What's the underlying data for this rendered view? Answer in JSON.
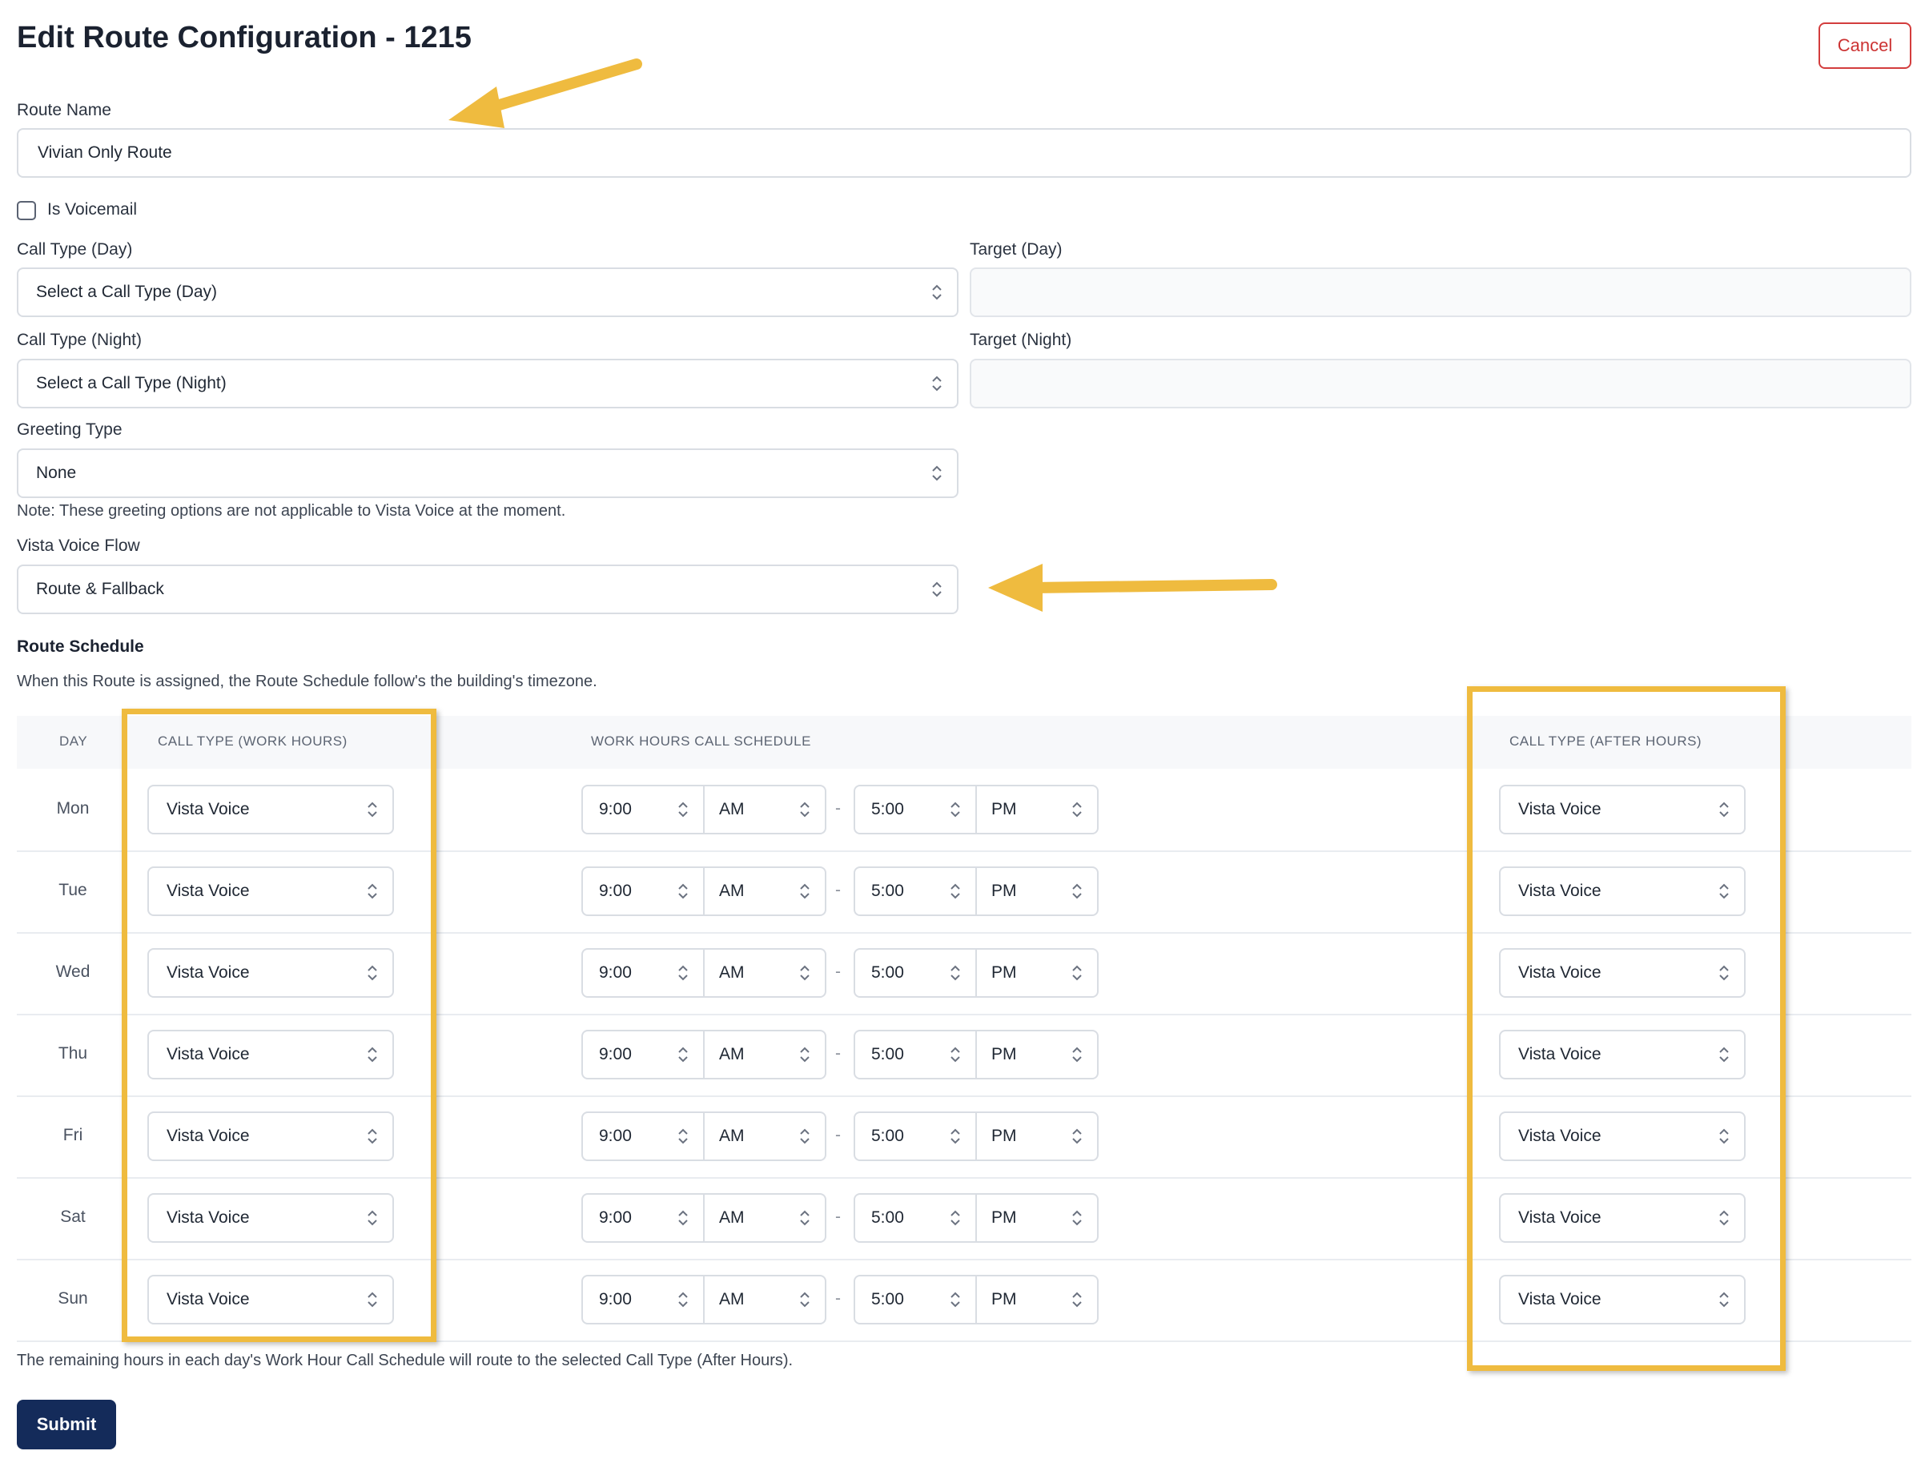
{
  "header": {
    "title": "Edit Route Configuration - 1215",
    "cancel_label": "Cancel"
  },
  "form": {
    "route_name_label": "Route Name",
    "route_name_value": "Vivian Only Route",
    "is_voicemail_label": "Is Voicemail",
    "is_voicemail_checked": false,
    "call_type_day_label": "Call Type (Day)",
    "call_type_day_value": "Select a Call Type (Day)",
    "target_day_label": "Target (Day)",
    "target_day_value": "",
    "call_type_night_label": "Call Type (Night)",
    "call_type_night_value": "Select a Call Type (Night)",
    "target_night_label": "Target (Night)",
    "target_night_value": "",
    "greeting_type_label": "Greeting Type",
    "greeting_type_value": "None",
    "greeting_note": "Note: These greeting options are not applicable to Vista Voice at the moment.",
    "vista_flow_label": "Vista Voice Flow",
    "vista_flow_value": "Route & Fallback"
  },
  "schedule": {
    "title": "Route Schedule",
    "description": "When this Route is assigned, the Route Schedule follow's the building's timezone.",
    "columns": {
      "day": "DAY",
      "work_type": "CALL TYPE (WORK HOURS)",
      "work_schedule": "WORK HOURS CALL SCHEDULE",
      "after_type": "CALL TYPE (AFTER HOURS)"
    },
    "rows": [
      {
        "day": "Mon",
        "work_type": "Vista Voice",
        "start": "9:00",
        "start_ampm": "AM",
        "end": "5:00",
        "end_ampm": "PM",
        "after_type": "Vista Voice"
      },
      {
        "day": "Tue",
        "work_type": "Vista Voice",
        "start": "9:00",
        "start_ampm": "AM",
        "end": "5:00",
        "end_ampm": "PM",
        "after_type": "Vista Voice"
      },
      {
        "day": "Wed",
        "work_type": "Vista Voice",
        "start": "9:00",
        "start_ampm": "AM",
        "end": "5:00",
        "end_ampm": "PM",
        "after_type": "Vista Voice"
      },
      {
        "day": "Thu",
        "work_type": "Vista Voice",
        "start": "9:00",
        "start_ampm": "AM",
        "end": "5:00",
        "end_ampm": "PM",
        "after_type": "Vista Voice"
      },
      {
        "day": "Fri",
        "work_type": "Vista Voice",
        "start": "9:00",
        "start_ampm": "AM",
        "end": "5:00",
        "end_ampm": "PM",
        "after_type": "Vista Voice"
      },
      {
        "day": "Sat",
        "work_type": "Vista Voice",
        "start": "9:00",
        "start_ampm": "AM",
        "end": "5:00",
        "end_ampm": "PM",
        "after_type": "Vista Voice"
      },
      {
        "day": "Sun",
        "work_type": "Vista Voice",
        "start": "9:00",
        "start_ampm": "AM",
        "end": "5:00",
        "end_ampm": "PM",
        "after_type": "Vista Voice"
      }
    ],
    "time_separator": "-",
    "footer_note": "The remaining hours in each day's Work Hour Call Schedule will route to the selected Call Type (After Hours)."
  },
  "submit_label": "Submit",
  "colors": {
    "highlight": "#efbb3f",
    "primary": "#142b5a",
    "danger": "#cc3333"
  },
  "icons": {
    "select_chevron": "chevron-up-down-icon",
    "annotation_arrow": "arrow-icon"
  }
}
